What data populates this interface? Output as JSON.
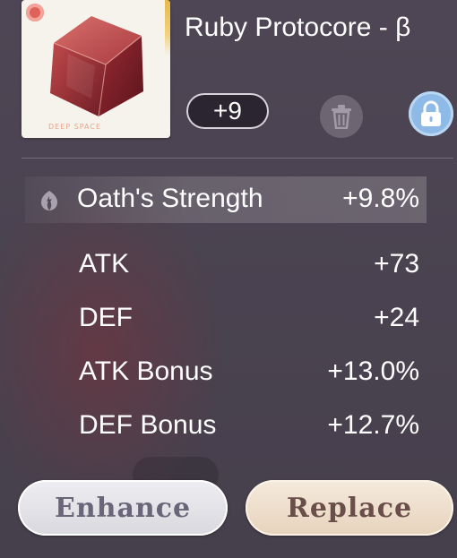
{
  "item": {
    "name": "Ruby Protocore - β",
    "level": "+9",
    "card_label": "DEEP SPACE"
  },
  "icons": {
    "trash": "trash-icon",
    "lock": "lock-icon",
    "oath": "oath-strength-icon",
    "rarity": "rarity-icon"
  },
  "main_stat": {
    "name": "Oath's Strength",
    "value": "+9.8%"
  },
  "sub_stats": [
    {
      "name": "ATK",
      "value": "+73"
    },
    {
      "name": "DEF",
      "value": "+24"
    },
    {
      "name": "ATK Bonus",
      "value": "+13.0%"
    },
    {
      "name": "DEF Bonus",
      "value": "+12.7%"
    }
  ],
  "buttons": {
    "enhance": "Enhance",
    "replace": "Replace"
  },
  "colors": {
    "background": "#4a4350",
    "lock_blue": "#8ebae8",
    "ruby": "#b0353f"
  }
}
